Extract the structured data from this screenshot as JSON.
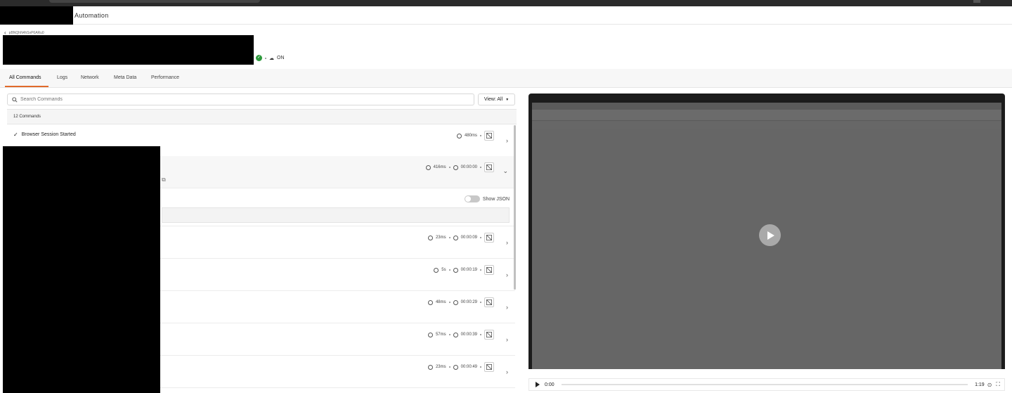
{
  "header": {
    "app_title": "Automation"
  },
  "breadcrumb": {
    "back_icon": "chevron-left-icon",
    "session_id": "pBNQhN4hSvP6ARu0"
  },
  "status": {
    "label": "ON",
    "passed_color": "#2e9a3e"
  },
  "tabs": [
    {
      "label": "All Commands",
      "active": true
    },
    {
      "label": "Logs"
    },
    {
      "label": "Network"
    },
    {
      "label": "Meta Data"
    },
    {
      "label": "Performance"
    }
  ],
  "search": {
    "placeholder": "Search Commands"
  },
  "view": {
    "label": "View: All"
  },
  "commands": {
    "count_label": "12 Commands",
    "rows": [
      {
        "name": "Browser Session Started",
        "duration": "480ms",
        "elapsed": ""
      },
      {
        "name": "",
        "duration": "416ms",
        "elapsed": "00:00:00"
      },
      {
        "name": "",
        "duration": "23ms",
        "elapsed": "00:00:09"
      },
      {
        "name": "",
        "duration": "5s",
        "elapsed": "00:00:19"
      },
      {
        "name": "",
        "duration": "48ms",
        "elapsed": "00:00:29"
      },
      {
        "name": "",
        "duration": "57ms",
        "elapsed": "00:00:39"
      },
      {
        "name": "",
        "duration": "23ms",
        "elapsed": "00:00:49"
      }
    ],
    "show_json_label": "Show JSON"
  },
  "video": {
    "current_time": "0:00",
    "duration": "1:19"
  },
  "colors": {
    "accent": "#e06a2a"
  }
}
